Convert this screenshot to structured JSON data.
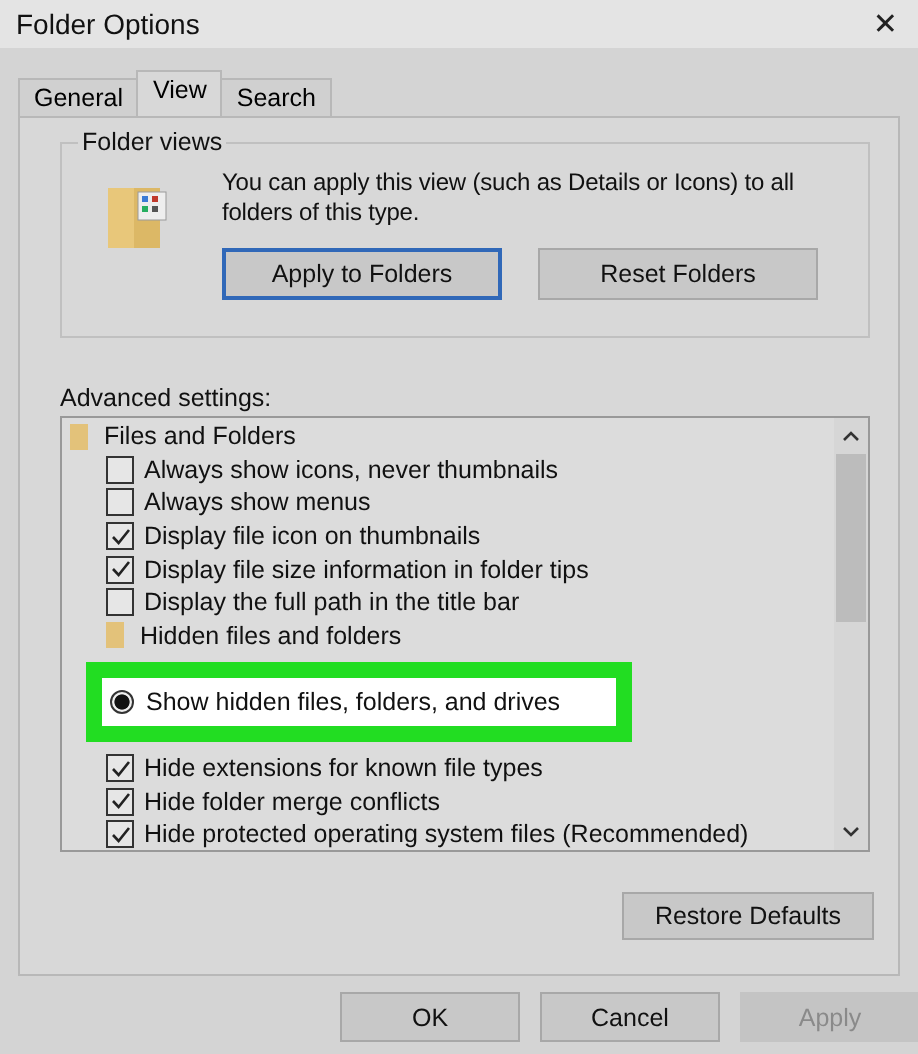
{
  "window": {
    "title": "Folder Options",
    "close": "✕"
  },
  "tabs": [
    {
      "label": "General",
      "selected": false
    },
    {
      "label": "View",
      "selected": true
    },
    {
      "label": "Search",
      "selected": false
    }
  ],
  "folder_views": {
    "title": "Folder views",
    "text": "You can apply this view (such as Details or Icons) to all folders of this type.",
    "buttons": [
      {
        "label": "Apply to Folders",
        "focused": true
      },
      {
        "label": "Reset Folders",
        "focused": false
      }
    ]
  },
  "advanced": {
    "label": "Advanced settings:",
    "items": [
      {
        "kind": "folder",
        "label": "Files and Folders",
        "children": [
          {
            "kind": "check",
            "label": "Always show icons, never thumbnails",
            "checked": false
          },
          {
            "kind": "check",
            "label": "Always show menus",
            "checked": false
          },
          {
            "kind": "check",
            "label": "Display file icon on thumbnails",
            "checked": true
          },
          {
            "kind": "check",
            "label": "Display file size information in folder tips",
            "checked": true
          },
          {
            "kind": "check",
            "label": "Display the full path in the title bar",
            "checked": false
          },
          {
            "kind": "folder",
            "label": "Hidden files and folders",
            "children": [
              {
                "kind": "radio",
                "label": "Show hidden files, folders, and drives",
                "selected": true,
                "highlighted": true
              }
            ]
          },
          {
            "kind": "check",
            "label": "Hide extensions for known file types",
            "checked": true
          },
          {
            "kind": "check",
            "label": "Hide folder merge conflicts",
            "checked": true
          },
          {
            "kind": "check",
            "label": "Hide protected operating system files (Recommended)",
            "checked": true
          }
        ]
      }
    ]
  },
  "restore_button": "Restore Defaults",
  "buttons": [
    {
      "label": "OK",
      "disabled": false
    },
    {
      "label": "Cancel",
      "disabled": false
    },
    {
      "label": "Apply",
      "disabled": true
    }
  ]
}
